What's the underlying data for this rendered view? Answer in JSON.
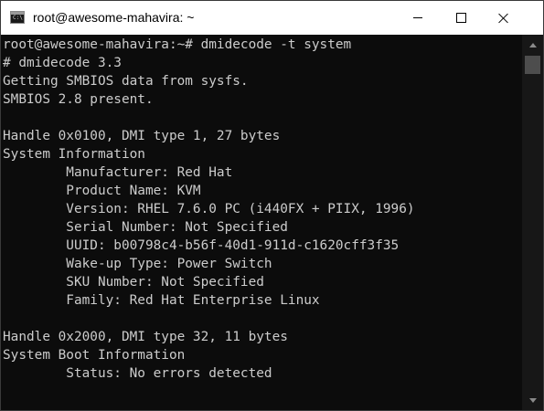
{
  "window": {
    "title": "root@awesome-mahavira: ~",
    "app_icon": "terminal-icon",
    "controls": {
      "minimize_icon": "minimize-icon",
      "maximize_icon": "maximize-icon",
      "close_icon": "close-icon"
    }
  },
  "colors": {
    "terminal_background": "#0c0c0c",
    "terminal_text": "#cccccc",
    "titlebar_background": "#ffffff"
  },
  "terminal": {
    "lines": [
      "root@awesome-mahavira:~# dmidecode -t system",
      "# dmidecode 3.3",
      "Getting SMBIOS data from sysfs.",
      "SMBIOS 2.8 present.",
      "",
      "Handle 0x0100, DMI type 1, 27 bytes",
      "System Information",
      "        Manufacturer: Red Hat",
      "        Product Name: KVM",
      "        Version: RHEL 7.6.0 PC (i440FX + PIIX, 1996)",
      "        Serial Number: Not Specified",
      "        UUID: b00798c4-b56f-40d1-911d-c1620cff3f35",
      "        Wake-up Type: Power Switch",
      "        SKU Number: Not Specified",
      "        Family: Red Hat Enterprise Linux",
      "",
      "Handle 0x2000, DMI type 32, 11 bytes",
      "System Boot Information",
      "        Status: No errors detected"
    ]
  },
  "scrollbar": {
    "up_icon": "scroll-up-arrow-icon",
    "down_icon": "scroll-down-arrow-icon"
  }
}
